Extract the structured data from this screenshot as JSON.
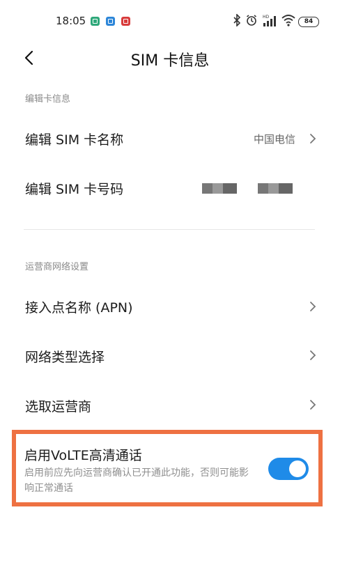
{
  "status_bar": {
    "time": "18:05",
    "battery": "84",
    "signal_label": "HD"
  },
  "header": {
    "title": "SIM 卡信息"
  },
  "section_edit": {
    "label": "编辑卡信息",
    "items": [
      {
        "label": "编辑 SIM 卡名称",
        "value": "中国电信"
      },
      {
        "label": "编辑 SIM 卡号码"
      }
    ]
  },
  "section_network": {
    "label": "运营商网络设置",
    "items": [
      {
        "label": "接入点名称 (APN)"
      },
      {
        "label": "网络类型选择"
      },
      {
        "label": "选取运营商"
      }
    ]
  },
  "volte": {
    "title": "启用VoLTE高清通话",
    "description": "启用前应先向运营商确认已开通此功能，否则可能影响正常通话",
    "enabled": true
  },
  "colors": {
    "accent": "#1f8be8",
    "highlight_border": "#ee7142"
  }
}
